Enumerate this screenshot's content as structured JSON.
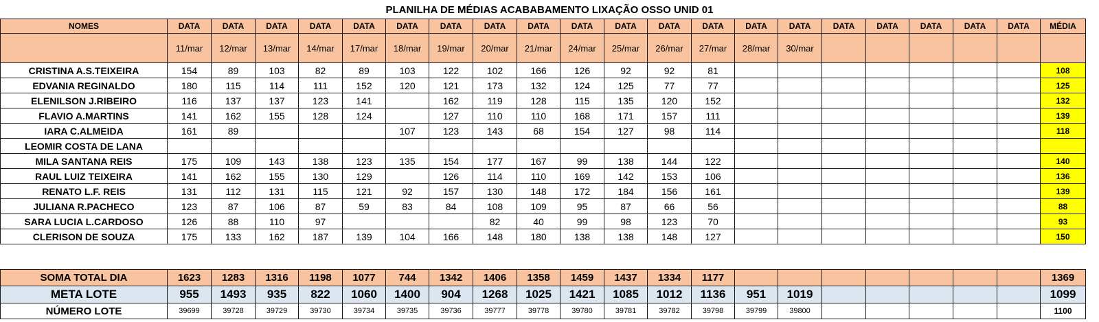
{
  "title": "PLANILHA DE MÉDIAS ACABABAMENTO LIXAÇÃO OSSO UNID 01",
  "header": {
    "names_label": "NOMES",
    "data_label": "DATA",
    "media_label": "MÉDIA",
    "dates": [
      "11/mar",
      "12/mar",
      "13/mar",
      "14/mar",
      "17/mar",
      "18/mar",
      "19/mar",
      "20/mar",
      "21/mar",
      "24/mar",
      "25/mar",
      "26/mar",
      "27/mar",
      "28/mar",
      "30/mar",
      "",
      "",
      "",
      "",
      ""
    ]
  },
  "rows": [
    {
      "name": "CRISTINA A.S.TEIXEIRA",
      "values": [
        "154",
        "89",
        "103",
        "82",
        "89",
        "103",
        "122",
        "102",
        "166",
        "126",
        "92",
        "92",
        "81",
        "",
        "",
        "",
        "",
        "",
        "",
        ""
      ],
      "media": "108"
    },
    {
      "name": "EDVANIA REGINALDO",
      "values": [
        "180",
        "115",
        "114",
        "111",
        "152",
        "120",
        "121",
        "173",
        "132",
        "124",
        "125",
        "77",
        "77",
        "",
        "",
        "",
        "",
        "",
        "",
        ""
      ],
      "media": "125"
    },
    {
      "name": "ELENILSON J.RIBEIRO",
      "values": [
        "116",
        "137",
        "137",
        "123",
        "141",
        "",
        "162",
        "119",
        "128",
        "115",
        "135",
        "120",
        "152",
        "",
        "",
        "",
        "",
        "",
        "",
        ""
      ],
      "media": "132"
    },
    {
      "name": "FLAVIO A.MARTINS",
      "values": [
        "141",
        "162",
        "155",
        "128",
        "124",
        "",
        "127",
        "110",
        "110",
        "168",
        "171",
        "157",
        "111",
        "",
        "",
        "",
        "",
        "",
        "",
        ""
      ],
      "media": "139"
    },
    {
      "name": "IARA C.ALMEIDA",
      "values": [
        "161",
        "89",
        "",
        "",
        "",
        "107",
        "123",
        "143",
        "68",
        "154",
        "127",
        "98",
        "114",
        "",
        "",
        "",
        "",
        "",
        "",
        ""
      ],
      "media": "118"
    },
    {
      "name": "LEOMIR COSTA DE LANA",
      "values": [
        "",
        "",
        "",
        "",
        "",
        "",
        "",
        "",
        "",
        "",
        "",
        "",
        "",
        "",
        "",
        "",
        "",
        "",
        "",
        ""
      ],
      "media": ""
    },
    {
      "name": "MILA SANTANA REIS",
      "values": [
        "175",
        "109",
        "143",
        "138",
        "123",
        "135",
        "154",
        "177",
        "167",
        "99",
        "138",
        "144",
        "122",
        "",
        "",
        "",
        "",
        "",
        "",
        ""
      ],
      "media": "140"
    },
    {
      "name": "RAUL LUIZ TEIXEIRA",
      "values": [
        "141",
        "162",
        "155",
        "130",
        "129",
        "",
        "126",
        "114",
        "110",
        "169",
        "142",
        "153",
        "106",
        "",
        "",
        "",
        "",
        "",
        "",
        ""
      ],
      "media": "136"
    },
    {
      "name": "RENATO L.F. REIS",
      "values": [
        "131",
        "112",
        "131",
        "115",
        "121",
        "92",
        "157",
        "130",
        "148",
        "172",
        "184",
        "156",
        "161",
        "",
        "",
        "",
        "",
        "",
        "",
        ""
      ],
      "media": "139"
    },
    {
      "name": "JULIANA R.PACHECO",
      "values": [
        "123",
        "87",
        "106",
        "87",
        "59",
        "83",
        "84",
        "108",
        "109",
        "95",
        "87",
        "66",
        "56",
        "",
        "",
        "",
        "",
        "",
        "",
        ""
      ],
      "media": "88"
    },
    {
      "name": "SARA LUCIA L.CARDOSO",
      "values": [
        "126",
        "88",
        "110",
        "97",
        "",
        "",
        "",
        "82",
        "40",
        "99",
        "98",
        "123",
        "70",
        "",
        "",
        "",
        "",
        "",
        "",
        ""
      ],
      "media": "93"
    },
    {
      "name": "CLERISON DE SOUZA",
      "values": [
        "175",
        "133",
        "162",
        "187",
        "139",
        "104",
        "166",
        "148",
        "180",
        "138",
        "138",
        "148",
        "127",
        "",
        "",
        "",
        "",
        "",
        "",
        ""
      ],
      "media": "150"
    }
  ],
  "totals": {
    "soma": {
      "label": "SOMA TOTAL DIA",
      "values": [
        "1623",
        "1283",
        "1316",
        "1198",
        "1077",
        "744",
        "1342",
        "1406",
        "1358",
        "1459",
        "1437",
        "1334",
        "1177",
        "",
        "",
        "",
        "",
        "",
        "",
        ""
      ],
      "media": "1369"
    },
    "meta": {
      "label": "META LOTE",
      "values": [
        "955",
        "1493",
        "935",
        "822",
        "1060",
        "1400",
        "904",
        "1268",
        "1025",
        "1421",
        "1085",
        "1012",
        "1136",
        "951",
        "1019",
        "",
        "",
        "",
        "",
        ""
      ],
      "media": "1099"
    },
    "lote": {
      "label": "NÚMERO LOTE",
      "values": [
        "39699",
        "39728",
        "39729",
        "39730",
        "39734",
        "39735",
        "39736",
        "39777",
        "39778",
        "39780",
        "39781",
        "39782",
        "39798",
        "39799",
        "39800",
        "",
        "",
        "",
        "",
        ""
      ],
      "media": "1100"
    }
  },
  "colors": {
    "header_bg": "#f8c39e",
    "media_bg": "#ffff00",
    "meta_bg": "#dce6f1"
  }
}
